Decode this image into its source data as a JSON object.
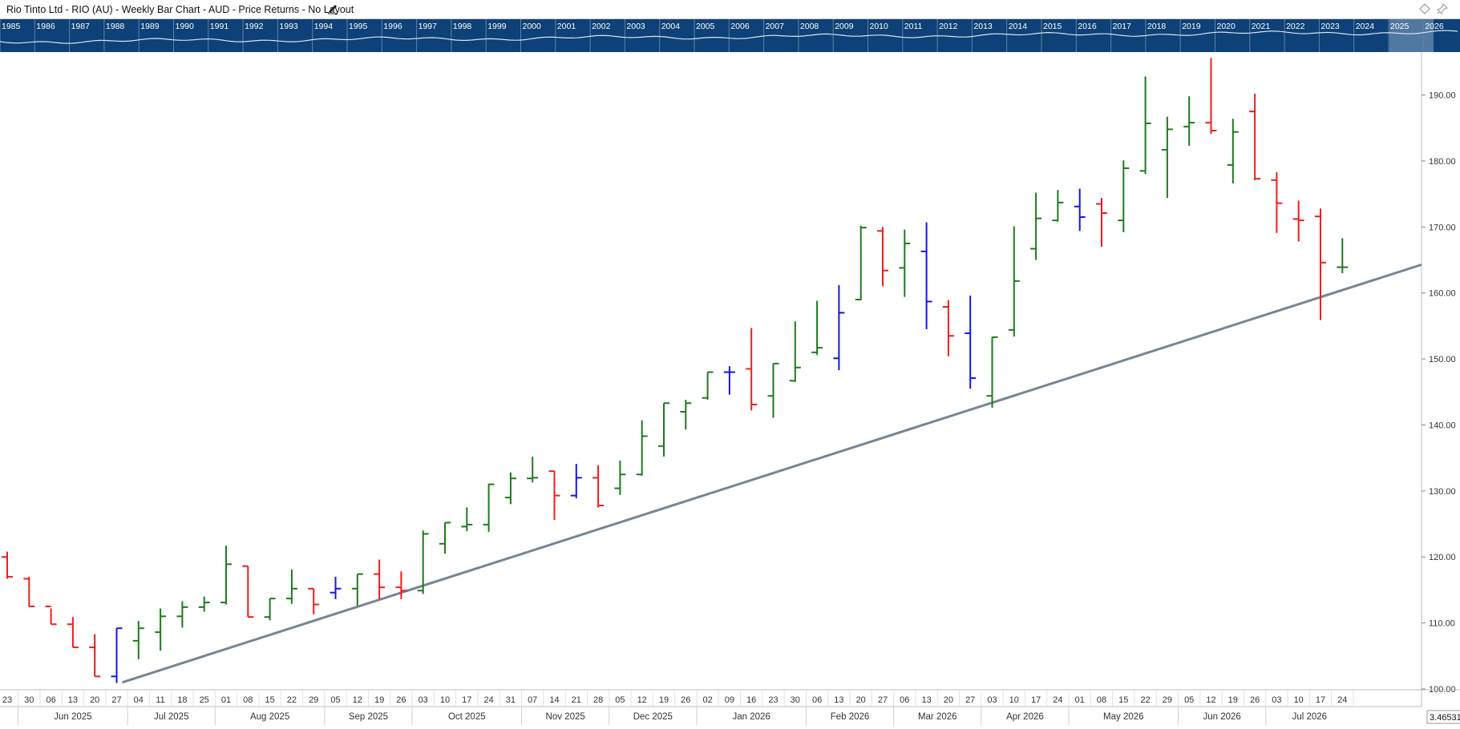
{
  "window": {
    "title": "Rio Tinto Ltd - RIO (AU) - Weekly Bar Chart - AUD - Price Returns - No Layout",
    "icons": [
      "pencil-icon",
      "diamond-icon",
      "pin-icon"
    ]
  },
  "overview": {
    "years": [
      "1985",
      "1986",
      "1987",
      "1988",
      "1989",
      "1990",
      "1991",
      "1992",
      "1993",
      "1994",
      "1995",
      "1996",
      "1997",
      "1998",
      "1999",
      "2000",
      "2001",
      "2002",
      "2003",
      "2004",
      "2005",
      "2006",
      "2007",
      "2008",
      "2009",
      "2010",
      "2011",
      "2012",
      "2013",
      "2014",
      "2015",
      "2016",
      "2017",
      "2018",
      "2019",
      "2020",
      "2021",
      "2022",
      "2023",
      "2024",
      "2025",
      "2026"
    ],
    "colors": {
      "background": "#0d4177",
      "line": "#d7e3f0",
      "selection": "#8aa6c4"
    }
  },
  "footer": {
    "corner_value": "3.46531"
  },
  "colors": {
    "up": "#1e7a1e",
    "down": "#f01c1c",
    "neutral": "#1414f0",
    "trendline": "#768594",
    "axis_text": "#333333",
    "grid": "#cfcfcf"
  },
  "chart_data": {
    "type": "bar",
    "subtype": "ohlc",
    "series": [
      {
        "name": "RIO (AU)",
        "weeks": [
          "23 May 2025",
          "30 May 2025",
          "06 Jun 2025",
          "13 Jun 2025",
          "20 Jun 2025",
          "27 Jun 2025",
          "04 Jul 2025",
          "11 Jul 2025",
          "18 Jul 2025",
          "25 Jul 2025",
          "01 Aug 2025",
          "08 Aug 2025",
          "15 Aug 2025",
          "22 Aug 2025",
          "29 Aug 2025",
          "05 Sep 2025",
          "12 Sep 2025",
          "19 Sep 2025",
          "26 Sep 2025",
          "03 Oct 2025",
          "10 Oct 2025",
          "17 Oct 2025",
          "24 Oct 2025",
          "31 Oct 2025",
          "07 Nov 2025",
          "14 Nov 2025",
          "21 Nov 2025",
          "28 Nov 2025",
          "05 Dec 2025",
          "12 Dec 2025",
          "19 Dec 2025",
          "26 Dec 2025",
          "02 Jan 2026",
          "09 Jan 2026",
          "16 Jan 2026",
          "23 Jan 2026",
          "30 Jan 2026",
          "06 Feb 2026",
          "13 Feb 2026",
          "20 Feb 2026",
          "27 Feb 2026",
          "06 Mar 2026",
          "13 Mar 2026",
          "20 Mar 2026",
          "27 Mar 2026",
          "03 Apr 2026",
          "10 Apr 2026",
          "17 Apr 2026",
          "24 Apr 2026",
          "01 May 2026",
          "08 May 2026",
          "15 May 2026",
          "22 May 2026",
          "29 May 2026",
          "05 Jun 2026",
          "12 Jun 2026",
          "19 Jun 2026",
          "26 Jun 2026",
          "03 Jul 2026",
          "10 Jul 2026",
          "17 Jul 2026"
        ],
        "ohlc": [
          [
            120.0,
            120.8,
            116.7,
            117.0
          ],
          [
            116.7,
            117.0,
            112.5,
            112.5
          ],
          [
            112.5,
            112.2,
            109.8,
            109.8
          ],
          [
            109.8,
            110.9,
            106.3,
            106.3
          ],
          [
            106.3,
            108.3,
            101.9,
            101.9
          ],
          [
            101.9,
            109.2,
            100.9,
            109.2
          ],
          [
            107.3,
            110.3,
            104.5,
            109.2
          ],
          [
            108.6,
            112.2,
            105.8,
            111.0
          ],
          [
            111.0,
            113.3,
            109.3,
            112.4
          ],
          [
            112.4,
            114.0,
            111.7,
            113.1
          ],
          [
            113.1,
            121.7,
            112.8,
            118.9
          ],
          [
            118.6,
            118.6,
            110.9,
            110.9
          ],
          [
            110.9,
            113.7,
            110.4,
            113.7
          ],
          [
            113.7,
            118.1,
            112.9,
            115.2
          ],
          [
            115.2,
            115.2,
            111.3,
            112.8
          ],
          [
            114.6,
            117.0,
            113.6,
            115.2
          ],
          [
            115.2,
            117.4,
            112.6,
            117.4
          ],
          [
            117.4,
            119.6,
            113.6,
            115.4
          ],
          [
            115.4,
            117.8,
            113.6,
            114.9
          ],
          [
            114.9,
            124.0,
            114.4,
            123.5
          ],
          [
            122.0,
            125.2,
            120.5,
            125.2
          ],
          [
            124.6,
            127.5,
            123.9,
            124.9
          ],
          [
            124.9,
            131.1,
            123.8,
            131.0
          ],
          [
            129.0,
            132.8,
            128.0,
            131.9
          ],
          [
            131.9,
            135.2,
            131.3,
            132.0
          ],
          [
            133.0,
            133.0,
            125.6,
            129.3
          ],
          [
            129.3,
            134.1,
            128.9,
            132.0
          ],
          [
            132.0,
            133.9,
            127.5,
            127.8
          ],
          [
            130.4,
            134.6,
            129.4,
            132.5
          ],
          [
            132.5,
            140.7,
            132.3,
            138.3
          ],
          [
            136.8,
            143.3,
            135.2,
            143.3
          ],
          [
            142.0,
            143.8,
            139.3,
            143.3
          ],
          [
            144.1,
            148.0,
            143.8,
            148.0
          ],
          [
            148.0,
            148.9,
            144.6,
            148.0
          ],
          [
            148.5,
            154.7,
            142.2,
            143.1
          ],
          [
            144.4,
            149.3,
            141.1,
            149.3
          ],
          [
            146.7,
            155.7,
            146.5,
            148.7
          ],
          [
            151.0,
            158.8,
            150.6,
            151.7
          ],
          [
            150.1,
            161.2,
            148.3,
            157.0
          ],
          [
            159.0,
            170.2,
            158.9,
            169.9
          ],
          [
            169.4,
            170.0,
            161.0,
            163.4
          ],
          [
            163.8,
            169.6,
            159.4,
            167.5
          ],
          [
            166.3,
            170.7,
            154.5,
            158.7
          ],
          [
            157.9,
            158.9,
            150.4,
            153.5
          ],
          [
            153.9,
            159.6,
            145.5,
            147.1
          ],
          [
            144.4,
            153.3,
            142.6,
            153.3
          ],
          [
            154.4,
            170.1,
            153.4,
            161.8
          ],
          [
            166.7,
            175.2,
            165.0,
            171.3
          ],
          [
            171.0,
            175.6,
            170.8,
            173.7
          ],
          [
            173.1,
            175.8,
            169.4,
            171.5
          ],
          [
            173.5,
            174.4,
            167.0,
            172.1
          ],
          [
            171.0,
            180.1,
            169.2,
            178.9
          ],
          [
            178.5,
            192.8,
            178.0,
            185.7
          ],
          [
            181.7,
            186.7,
            174.4,
            184.8
          ],
          [
            185.2,
            189.8,
            182.3,
            185.8
          ],
          [
            185.8,
            195.6,
            184.1,
            184.6
          ],
          [
            179.4,
            186.4,
            176.6,
            184.4
          ],
          [
            187.5,
            190.2,
            177.1,
            177.3
          ],
          [
            177.1,
            178.3,
            169.1,
            173.6
          ],
          [
            171.2,
            174.0,
            167.8,
            171.0
          ],
          [
            171.6,
            172.8,
            155.9,
            164.6
          ],
          [
            163.9,
            168.3,
            163.0,
            163.9
          ]
        ]
      }
    ],
    "ylim": [
      100,
      196.5
    ],
    "y_ticks": [
      "100.00",
      "110.00",
      "120.00",
      "130.00",
      "140.00",
      "150.00",
      "160.00",
      "170.00",
      "180.00",
      "190.00"
    ],
    "x_day_labels": [
      "23",
      "30",
      "06",
      "13",
      "20",
      "27",
      "04",
      "11",
      "18",
      "25",
      "01",
      "08",
      "15",
      "22",
      "29",
      "05",
      "12",
      "19",
      "26",
      "03",
      "10",
      "17",
      "24",
      "31",
      "07",
      "14",
      "21",
      "28",
      "05",
      "12",
      "19",
      "26",
      "02",
      "09",
      "16",
      "23",
      "30",
      "06",
      "13",
      "20",
      "27",
      "06",
      "13",
      "20",
      "27",
      "03",
      "10",
      "17",
      "24",
      "01",
      "08",
      "15",
      "22",
      "29",
      "05",
      "12",
      "19",
      "26",
      "03",
      "10",
      "17",
      "24"
    ],
    "x_month_labels": [
      "Jun 2025",
      "Jul 2025",
      "Aug 2025",
      "Sep 2025",
      "Oct 2025",
      "Nov 2025",
      "Dec 2025",
      "Jan 2026",
      "Feb 2026",
      "Mar 2026",
      "Apr 2026",
      "May 2026",
      "Jun 2026",
      "Jul 2026"
    ],
    "trendline": {
      "from": [
        "27 Jun 2025",
        101.0
      ],
      "to": [
        "24 Jul 2026",
        161.5
      ]
    },
    "grid": false,
    "legend": "none"
  }
}
